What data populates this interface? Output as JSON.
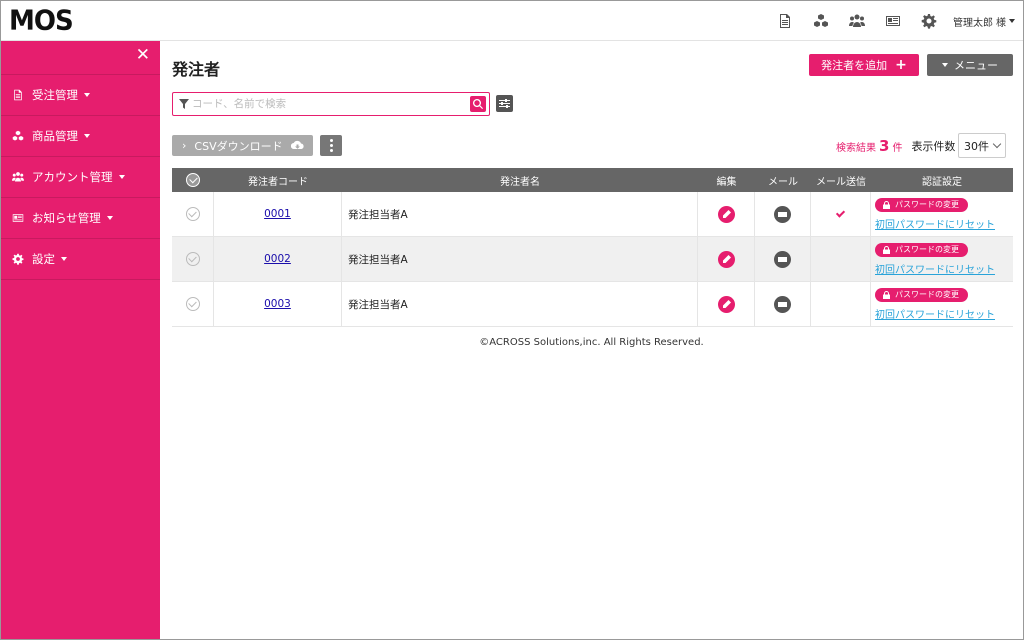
{
  "header": {
    "logo": "MOS",
    "user_name": "管理太郎",
    "user_suffix": "様",
    "icons": [
      "document-icon",
      "boxes-icon",
      "users-icon",
      "news-icon",
      "gear-icon"
    ]
  },
  "sidebar": {
    "close_symbol": "✕",
    "items": [
      {
        "label": "受注管理",
        "icon": "document-icon"
      },
      {
        "label": "商品管理",
        "icon": "boxes-icon"
      },
      {
        "label": "アカウント管理",
        "icon": "users-icon"
      },
      {
        "label": "お知らせ管理",
        "icon": "news-icon"
      },
      {
        "label": "設定",
        "icon": "gear-icon"
      }
    ]
  },
  "main": {
    "title": "発注者",
    "add_button": "発注者を追加",
    "menu_button": "メニュー",
    "search_placeholder": "コード、名前で検索",
    "search_value": "",
    "csv_button": "CSVダウンロード",
    "result_label": "検索結果",
    "result_count": "3",
    "result_unit": "件",
    "per_page_label": "表示件数",
    "per_page_value": "30件"
  },
  "table": {
    "headers": [
      "発注者コード",
      "発注者名",
      "編集",
      "メール",
      "メール送信",
      "認証設定"
    ],
    "rows": [
      {
        "code": "0001",
        "name": "発注担当者A",
        "mail_sent": true,
        "pw_change": "パスワードの変更",
        "reset": "初回パスワードにリセット"
      },
      {
        "code": "0002",
        "name": "発注担当者A",
        "mail_sent": false,
        "pw_change": "パスワードの変更",
        "reset": "初回パスワードにリセット"
      },
      {
        "code": "0003",
        "name": "発注担当者A",
        "mail_sent": false,
        "pw_change": "パスワードの変更",
        "reset": "初回パスワードにリセット"
      }
    ]
  },
  "footer": {
    "copyright": "©ACROSS Solutions,inc. All Rights Reserved."
  },
  "colors": {
    "accent": "#e61e6e",
    "header_gray": "#666666",
    "link_blue": "#1a0dab",
    "reset_link": "#29a3d9"
  }
}
